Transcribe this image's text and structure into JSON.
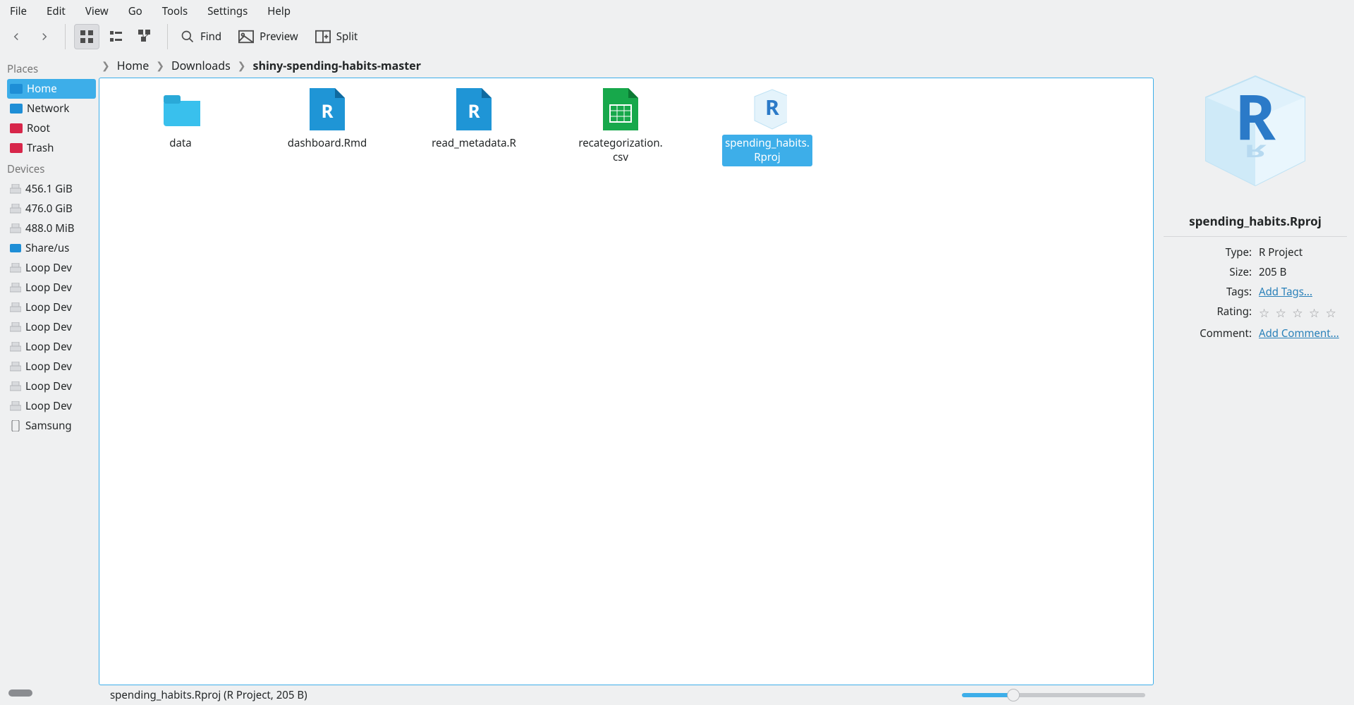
{
  "menu": {
    "items": [
      "File",
      "Edit",
      "View",
      "Go",
      "Tools",
      "Settings",
      "Help"
    ]
  },
  "toolbar": {
    "find": "Find",
    "preview": "Preview",
    "split": "Split"
  },
  "sidebar": {
    "places_header": "Places",
    "places": [
      {
        "label": "Home",
        "icon": "home",
        "selected": true
      },
      {
        "label": "Network",
        "icon": "network"
      },
      {
        "label": "Root",
        "icon": "root"
      },
      {
        "label": "Trash",
        "icon": "trash"
      }
    ],
    "devices_header": "Devices",
    "devices": [
      {
        "label": "456.1 GiB"
      },
      {
        "label": "476.0 GiB"
      },
      {
        "label": "488.0 MiB"
      },
      {
        "label": "Share/us",
        "icon": "folder"
      },
      {
        "label": "Loop Dev"
      },
      {
        "label": "Loop Dev"
      },
      {
        "label": "Loop Dev"
      },
      {
        "label": "Loop Dev"
      },
      {
        "label": "Loop Dev"
      },
      {
        "label": "Loop Dev"
      },
      {
        "label": "Loop Dev"
      },
      {
        "label": "Loop Dev"
      },
      {
        "label": "Samsung",
        "icon": "phone"
      }
    ]
  },
  "breadcrumb": {
    "items": [
      "Home",
      "Downloads"
    ],
    "current": "shiny-spending-habits-master"
  },
  "files": [
    {
      "name": "data",
      "kind": "folder"
    },
    {
      "name": "dashboard.Rmd",
      "kind": "rfile"
    },
    {
      "name": "read_metadata.R",
      "kind": "rfile"
    },
    {
      "name": "recategorization.csv",
      "kind": "csv"
    },
    {
      "name": "spending_habits.Rproj",
      "kind": "rproj",
      "selected": true
    }
  ],
  "info": {
    "filename": "spending_habits.Rproj",
    "type_k": "Type:",
    "type_v": "R Project",
    "size_k": "Size:",
    "size_v": "205 B",
    "tags_k": "Tags:",
    "tags_v": "Add Tags...",
    "rating_k": "Rating:",
    "comment_k": "Comment:",
    "comment_v": "Add Comment..."
  },
  "status": {
    "text": "spending_habits.Rproj (R Project, 205 B)"
  }
}
